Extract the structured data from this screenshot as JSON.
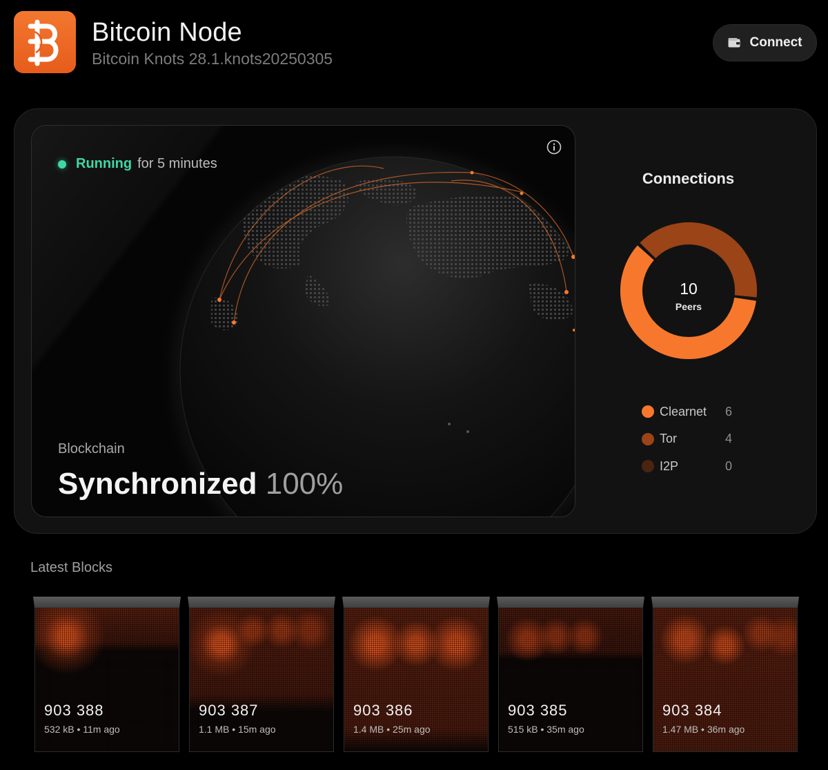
{
  "header": {
    "app_name": "Bitcoin Node",
    "version": "Bitcoin Knots 28.1.knots20250305",
    "connect_label": "Connect",
    "app_icon": "bitcoin-knots-logo"
  },
  "status": {
    "state": "Running",
    "duration": "for 5 minutes",
    "dot_color": "#3fd8a4"
  },
  "blockchain": {
    "label": "Blockchain",
    "status": "Synchronized",
    "percent": "100%"
  },
  "connections": {
    "title": "Connections",
    "total": "10",
    "unit": "Peers",
    "networks": [
      {
        "name": "Clearnet",
        "count": "6",
        "value": 6,
        "color": "#f7782c"
      },
      {
        "name": "Tor",
        "count": "4",
        "value": 4,
        "color": "#9b4417"
      },
      {
        "name": "I2P",
        "count": "0",
        "value": 0,
        "color": "#4a2410"
      }
    ]
  },
  "latest_blocks": {
    "title": "Latest Blocks",
    "blocks": [
      {
        "height": "903 388",
        "meta": "532 kB • 11m ago"
      },
      {
        "height": "903 387",
        "meta": "1.1 MB • 15m ago"
      },
      {
        "height": "903 386",
        "meta": "1.4 MB • 25m ago"
      },
      {
        "height": "903 385",
        "meta": "515 kB • 35m ago"
      },
      {
        "height": "903 384",
        "meta": "1.47 MB • 36m ago"
      }
    ]
  },
  "colors": {
    "accent": "#f7782c",
    "running": "#3fd8a4",
    "background": "#000000"
  }
}
